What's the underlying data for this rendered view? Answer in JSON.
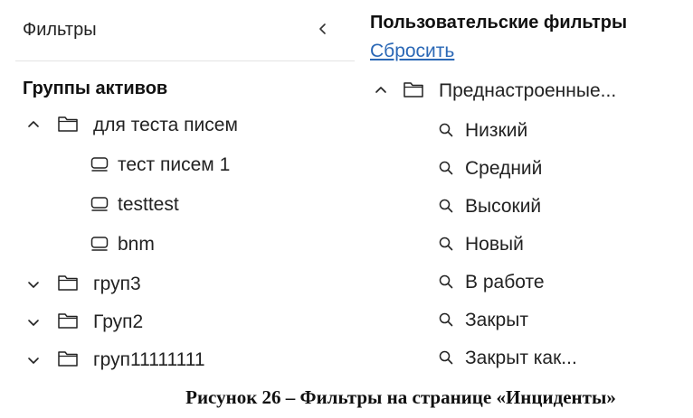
{
  "left_panel": {
    "title": "Фильтры",
    "section_title": "Группы активов",
    "groups": [
      {
        "label": "для теста писем",
        "expanded": true,
        "children": [
          "тест писем 1",
          "testtest",
          "bnm"
        ]
      },
      {
        "label": "груп3",
        "expanded": false
      },
      {
        "label": "Груп2",
        "expanded": false
      },
      {
        "label": "груп11111111",
        "expanded": false
      }
    ]
  },
  "right_panel": {
    "title": "Пользовательские фильтры",
    "reset_label": "Сбросить",
    "folder": {
      "label": "Преднастроенные...",
      "expanded": true
    },
    "filters": [
      "Низкий",
      "Средний",
      "Высокий",
      "Новый",
      "В работе",
      "Закрыт",
      "Закрыт как..."
    ]
  },
  "caption": "Рисунок 26 – Фильтры на странице «Инциденты»",
  "colors": {
    "link": "#2b68b6",
    "divider": "#e3e3e3",
    "text": "#1f1f1f"
  }
}
